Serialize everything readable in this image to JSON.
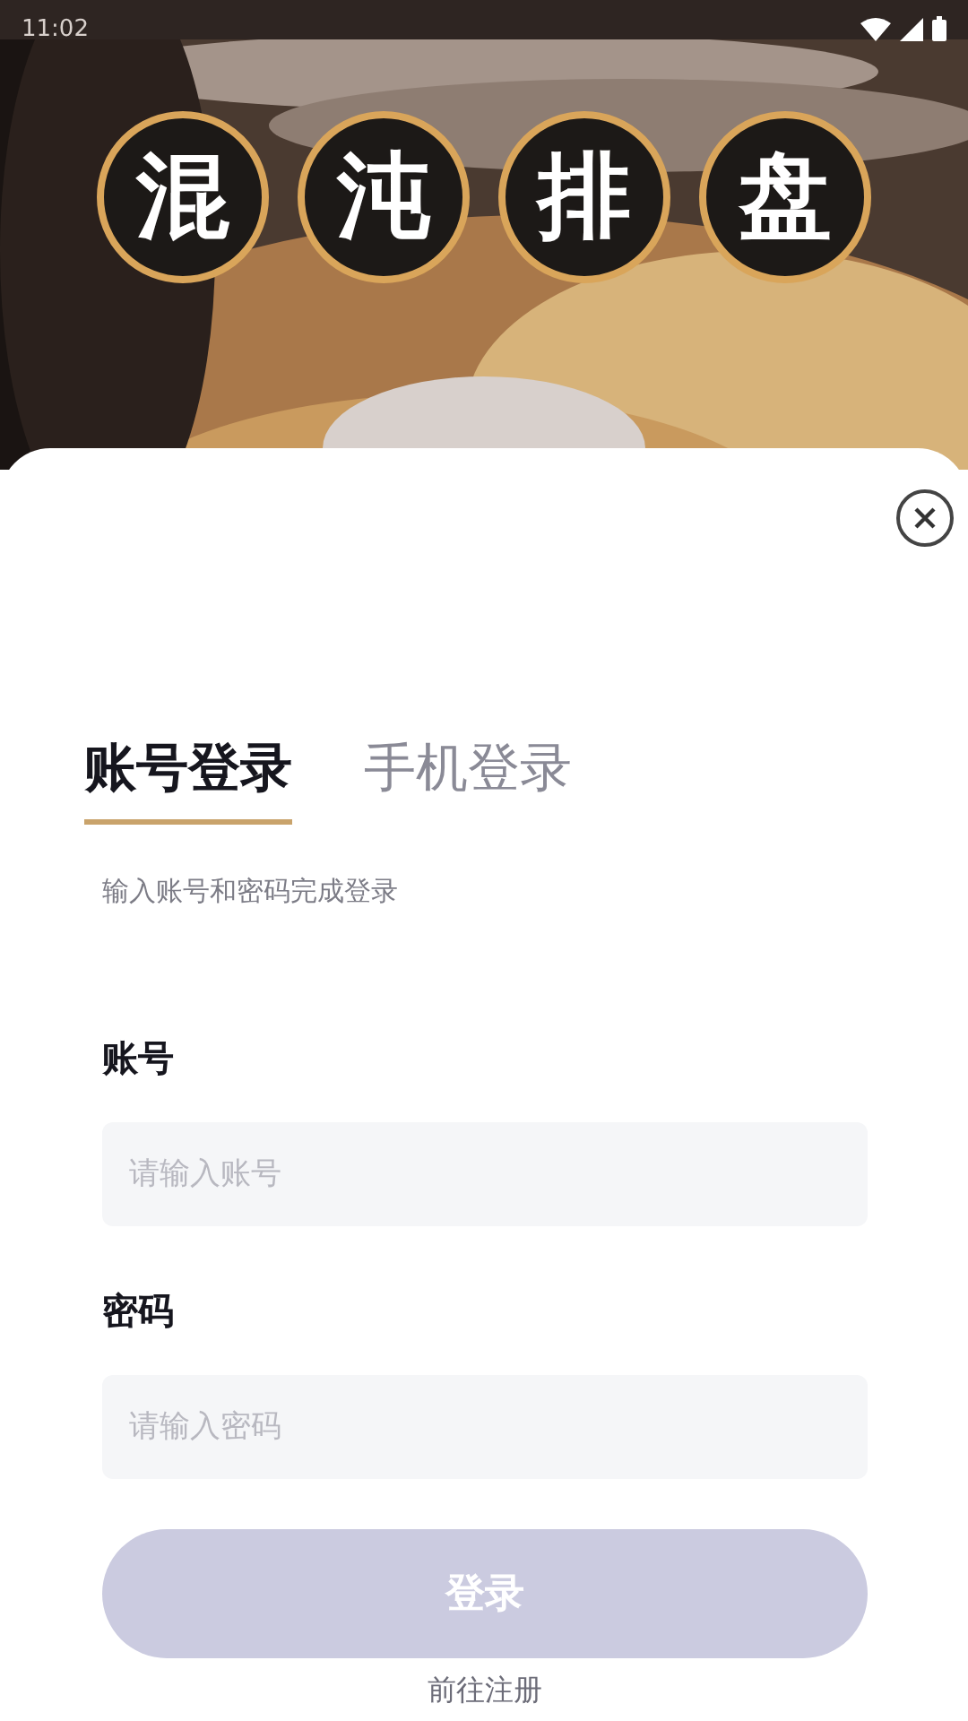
{
  "status_bar": {
    "time": "11:02"
  },
  "banner": {
    "characters": [
      "混",
      "沌",
      "排",
      "盘"
    ]
  },
  "tabs": [
    {
      "label": "账号登录",
      "selected": true
    },
    {
      "label": "手机登录",
      "selected": false
    }
  ],
  "hint": "输入账号和密码完成登录",
  "fields": [
    {
      "label": "账号",
      "placeholder": "请输入账号"
    },
    {
      "label": "密码",
      "placeholder": "请输入密码"
    }
  ],
  "login_button": {
    "label": "登录",
    "disabled": true
  },
  "register_link": "前往注册"
}
